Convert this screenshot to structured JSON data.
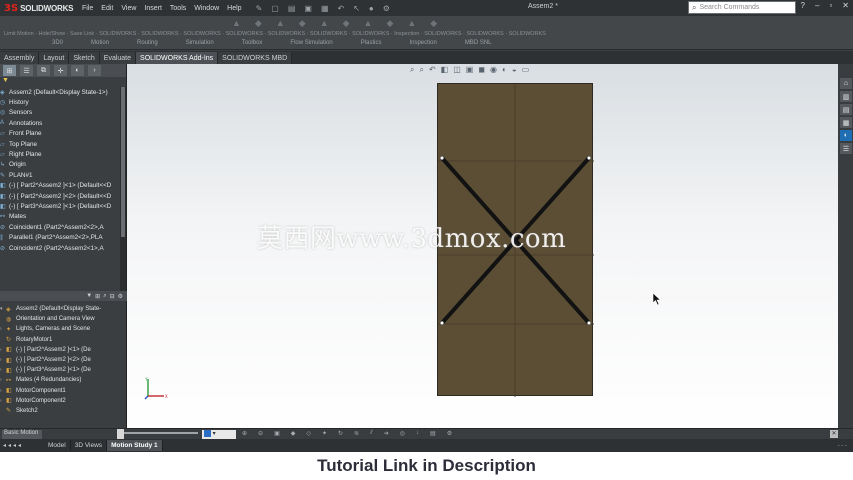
{
  "app": {
    "logo_mark": "3S",
    "logo_text": "SOLIDWORKS",
    "document_title": "Assem2 *"
  },
  "menu": [
    "File",
    "Edit",
    "View",
    "Insert",
    "Tools",
    "Window",
    "Help"
  ],
  "search": {
    "placeholder": "Search Commands"
  },
  "command_manager": {
    "row1": "Limit Motion  ·  Hide/Show  ·  Save Link  ·  SOLIDWORKS  ·  SOLIDWORKS  ·  SOLIDWORKS  ·  SOLIDWORKS  ·  SOLIDWORKS  ·  SOLIDWORKS  ·  SOLIDWORKS  ·  Inspection  ·  SOLIDWORKS  ·  SOLIDWORKS  ·  SOLIDWORKS",
    "groups": [
      "3D0",
      "Motion",
      "Routing",
      "Simulation",
      "Toolbox",
      "Flow Simulation",
      "Plastics",
      "Inspection",
      "MBD SNL"
    ]
  },
  "tabs": [
    "Assembly",
    "Layout",
    "Sketch",
    "Evaluate",
    "SOLIDWORKS Add-Ins",
    "SOLIDWORKS MBD"
  ],
  "active_tab": "SOLIDWORKS Add-Ins",
  "feature_tree": {
    "filter_icon": "filter-icon",
    "root": "Assem2  (Default<Display State-1>)",
    "items": [
      "History",
      "Sensors",
      "Annotations",
      "Front Plane",
      "Top Plane",
      "Right Plane",
      "Origin",
      "PLAN#1",
      "(-) [ Part2^Assem2 ]<1> (Default<<D",
      "(-) [ Part2^Assem2 ]<2> (Default<<D",
      "(-) [ Part3^Assem2 ]<1> (Default<<D",
      "Mates",
      "Coincident1 (Part2^Assem2<2>,A",
      "Parallel1 (Part2^Assem2<2>,PLA",
      "Coincident2 (Part2^Assem2<1>,A"
    ]
  },
  "motion_tree": {
    "root": "Assem2  (Default<Display State-",
    "items": [
      "Orientation and Camera View",
      "Lights, Cameras and Scene",
      "RotaryMotor1",
      "(-) [ Part2^Assem2 ]<1> (De",
      "(-) [ Part2^Assem2 ]<2> (De",
      "(-) [ Part3^Assem2 ]<1> (De",
      "Mates (4 Redundancies)",
      "MotorComponent1",
      "MotorComponent2",
      "Sketch2"
    ]
  },
  "viewport": {
    "watermark": "莫西网www.3dmox.com"
  },
  "motion_bar": {
    "study_type": "Basic Motion"
  },
  "bottom_tabs": [
    "Model",
    "3D Views",
    "Motion Study 1"
  ],
  "active_bottom_tab": "Motion Study 1",
  "status": "- - -",
  "caption": "Tutorial Link in Description",
  "colors": {
    "plate": "#5b4e35",
    "accent": "#1f6db3",
    "brand": "#e2231a"
  }
}
